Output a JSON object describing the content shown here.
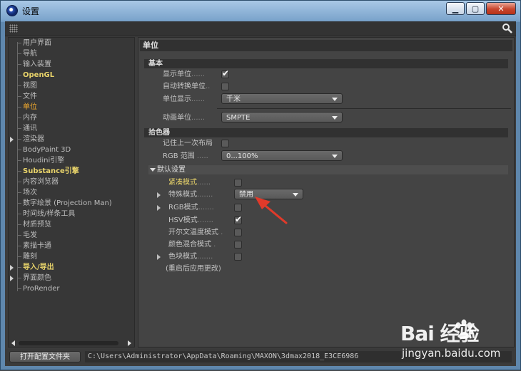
{
  "window": {
    "title": "设置"
  },
  "tree": {
    "items": [
      {
        "label": "用户界面",
        "style": "normal",
        "arrow": false
      },
      {
        "label": "导航",
        "style": "normal",
        "arrow": false
      },
      {
        "label": "输入装置",
        "style": "normal",
        "arrow": false
      },
      {
        "label": "OpenGL",
        "style": "hl",
        "arrow": false
      },
      {
        "label": "视图",
        "style": "normal",
        "arrow": false
      },
      {
        "label": "文件",
        "style": "normal",
        "arrow": false
      },
      {
        "label": "单位",
        "style": "active",
        "arrow": false
      },
      {
        "label": "内存",
        "style": "normal",
        "arrow": false
      },
      {
        "label": "通讯",
        "style": "normal",
        "arrow": false
      },
      {
        "label": "渲染器",
        "style": "normal",
        "arrow": true
      },
      {
        "label": "BodyPaint 3D",
        "style": "normal",
        "arrow": false
      },
      {
        "label": "Houdini引擎",
        "style": "normal",
        "arrow": false
      },
      {
        "label": "Substance引擎",
        "style": "hl",
        "arrow": false
      },
      {
        "label": "内容浏览器",
        "style": "normal",
        "arrow": false
      },
      {
        "label": "场次",
        "style": "normal",
        "arrow": false
      },
      {
        "label": "数字绘景 (Projection Man)",
        "style": "normal",
        "arrow": false
      },
      {
        "label": "时间线/样条工具",
        "style": "normal",
        "arrow": false
      },
      {
        "label": "材质预览",
        "style": "normal",
        "arrow": false
      },
      {
        "label": "毛发",
        "style": "normal",
        "arrow": false
      },
      {
        "label": "素描卡通",
        "style": "normal",
        "arrow": false
      },
      {
        "label": "雕刻",
        "style": "normal",
        "arrow": false
      },
      {
        "label": "导入/导出",
        "style": "hl",
        "arrow": true
      },
      {
        "label": "界面颜色",
        "style": "normal",
        "arrow": true
      },
      {
        "label": "ProRender",
        "style": "normal",
        "arrow": false
      }
    ]
  },
  "panel": {
    "title": "单位",
    "basic": {
      "header": "基本",
      "show_units_label": "显示单位",
      "show_units_checked": true,
      "auto_convert_label": "自动转换单位",
      "auto_convert_checked": false,
      "unit_display_label": "单位显示",
      "unit_display_value": "千米",
      "anim_unit_label": "动画单位",
      "anim_unit_value": "SMPTE"
    },
    "color_picker": {
      "header": "拾色器",
      "remember_layout_label": "记住上一次布局",
      "remember_layout_checked": false,
      "rgb_range_label": "RGB 范围",
      "rgb_range_value": "0...100%",
      "defaults_header": "默认设置",
      "compact_label": "紧凑模式",
      "compact_checked": false,
      "special_label": "特殊模式",
      "special_value": "禁用",
      "rgb_mode_label": "RGB模式",
      "rgb_mode_checked": false,
      "hsv_label": "HSV模式",
      "hsv_checked": true,
      "kelvin_label": "开尔文温度模式",
      "kelvin_checked": false,
      "mix_label": "颜色混合模式",
      "mix_checked": false,
      "swatch_label": "色块模式",
      "swatch_checked": false,
      "restart_note": "(重启后应用更改)"
    }
  },
  "bottom": {
    "open_button": "打开配置文件夹",
    "path": "C:\\Users\\Administrator\\AppData\\Roaming\\MAXON\\3dmax2018_E3CE6986"
  },
  "watermark": {
    "brand": "Bai  经验",
    "url": "jingyan.baidu.com"
  },
  "colors": {
    "accent_active": "#f0a92e",
    "accent_highlight": "#e8d36a",
    "annotation_arrow": "#e03a2a"
  }
}
